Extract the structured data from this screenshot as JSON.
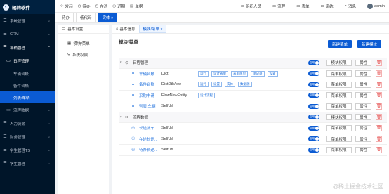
{
  "app": {
    "title": "驰骋软件"
  },
  "sidebar": {
    "items": [
      {
        "icon": "☰",
        "label": "系统管理",
        "chevron": "⌄"
      },
      {
        "icon": "☰",
        "label": "CRM",
        "chevron": "⌄"
      },
      {
        "icon": "☰",
        "label": "车辆管理",
        "chevron": "⌃"
      },
      {
        "icon": "▭",
        "label": "日程管理",
        "chevron": "⌃"
      },
      {
        "icon": "",
        "label": "车辆台账"
      },
      {
        "icon": "",
        "label": "备件台账"
      },
      {
        "icon": "",
        "label": "列表:车辆"
      },
      {
        "icon": "▭",
        "label": "流程数据",
        "chevron": "⌄"
      },
      {
        "icon": "☰",
        "label": "人力资源",
        "chevron": "⌄"
      },
      {
        "icon": "☰",
        "label": "财务管理",
        "chevron": "⌄"
      },
      {
        "icon": "☰",
        "label": "学生管理TS",
        "chevron": "⌄"
      },
      {
        "icon": "☰",
        "label": "学生管理",
        "chevron": "⌄"
      }
    ]
  },
  "topbar": {
    "items": [
      {
        "icon": "✈",
        "label": "发起"
      },
      {
        "icon": "◷",
        "label": "待办"
      },
      {
        "icon": "◴",
        "label": "在途"
      },
      {
        "icon": "◷",
        "label": "近期"
      },
      {
        "icon": "▤",
        "label": "单据"
      }
    ],
    "right": [
      {
        "icon": "▭",
        "label": "组织人员"
      },
      {
        "icon": "▭",
        "label": "流程"
      },
      {
        "icon": "▭",
        "label": "表单"
      },
      {
        "icon": "▭",
        "label": "系统"
      },
      {
        "icon": "◔",
        "label": "消息"
      }
    ],
    "user": "admin"
  },
  "page_tabs": [
    {
      "label": "待办"
    },
    {
      "label": "低代码"
    },
    {
      "label": "实体 ×"
    }
  ],
  "left_panel": {
    "header": "基本设置",
    "items": [
      {
        "icon": "▦",
        "label": "模块/菜单"
      },
      {
        "icon": "⚲",
        "label": "系统权限"
      }
    ]
  },
  "main": {
    "tabs": [
      {
        "icon": "⌂",
        "label": "基本信息"
      },
      {
        "label": "模块/菜单 ×"
      }
    ],
    "heading": "模块/菜单",
    "new_menu_btn": "新建菜单",
    "new_module_btn": "新建模块",
    "rows": [
      {
        "type": "group",
        "caret": "▾",
        "icon": "⊙",
        "name": "日程管理",
        "toggle": "启用",
        "btn1": "模块权限",
        "btn2": "属性",
        "del": "🗑"
      },
      {
        "type": "item",
        "icon": "⚭",
        "name": "车辆台账",
        "value": "Dict",
        "tags": [
          "运行",
          "设计表单",
          "表单简单",
          "单记录",
          "设置"
        ],
        "toggle": "启用",
        "btn1": "菜单权限",
        "btn2": "属性",
        "del": "🗑"
      },
      {
        "type": "item",
        "icon": "⚭",
        "name": "备件台账",
        "value": "DictDtlView",
        "tags": [
          "运行",
          "设置",
          "实体",
          "数据源"
        ],
        "toggle": "启用",
        "btn1": "菜单权限",
        "btn2": "属性",
        "del": "🗑"
      },
      {
        "type": "item",
        "icon": "⚭",
        "name": "采购申请",
        "value": "FlowNewEntity",
        "tags": [
          "设计流程"
        ],
        "toggle": "启用",
        "btn1": "菜单权限",
        "btn2": "属性",
        "del": "🗑"
      },
      {
        "type": "item",
        "icon": "⚭",
        "name": "列表:车辆",
        "value": "SelfUrl",
        "tags": [],
        "toggle": "启用",
        "btn1": "菜单权限",
        "btn2": "属性",
        "del": "🗑"
      },
      {
        "type": "group",
        "caret": "▾",
        "icon": "☷",
        "name": "流程数据",
        "toggle": "启用",
        "btn1": "模块权限",
        "btn2": "属性",
        "del": "🗑"
      },
      {
        "type": "item",
        "icon": "⚇",
        "name": "长途派车...",
        "value": "SelfUrl",
        "tags": [],
        "toggle": "启用",
        "btn1": "菜单权限",
        "btn2": "属性",
        "del": "🗑"
      },
      {
        "type": "item",
        "icon": "⚇",
        "name": "在途长途...",
        "value": "SelfUrl",
        "tags": [],
        "toggle": "启用",
        "btn1": "菜单权限",
        "btn2": "属性",
        "del": "🗑"
      },
      {
        "type": "item",
        "icon": "⚇",
        "name": "待办长途...",
        "value": "SelfUrl",
        "tags": [],
        "toggle": "启用",
        "btn1": "菜单权限",
        "btn2": "属性",
        "del": "🗑"
      }
    ]
  },
  "watermark": "@稀土掘金技术社区"
}
